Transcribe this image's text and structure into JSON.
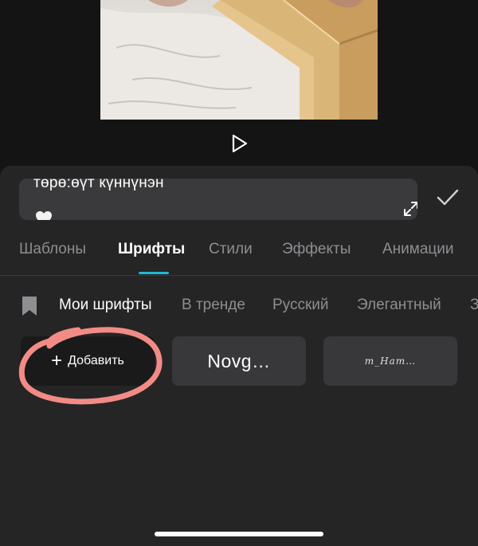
{
  "editor": {
    "text_value": "төрө:өүт күннүнэн",
    "heart_emoji": "🤍"
  },
  "tabs": [
    "Шаблоны",
    "Шрифты",
    "Стили",
    "Эффекты",
    "Анимации"
  ],
  "active_tab": "Шрифты",
  "categories": [
    "Мои шрифты",
    "В тренде",
    "Русский",
    "Элегантный",
    "З"
  ],
  "active_category": "Мои шрифты",
  "fonts": {
    "add_label": "Добавить",
    "add_plus": "+",
    "card2": "Novg…",
    "card3": "m_Ham…"
  },
  "colors": {
    "accent": "#1fb8d6",
    "sheet_bg": "#252525",
    "annotation": "#f28b86"
  },
  "icons": [
    "play-icon",
    "expand-icon",
    "checkmark-icon",
    "bookmark-icon",
    "plus-icon"
  ]
}
